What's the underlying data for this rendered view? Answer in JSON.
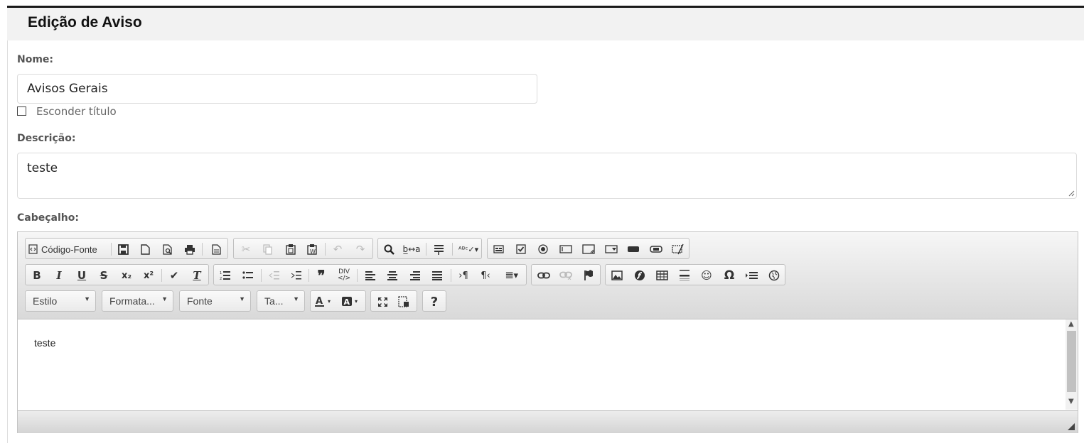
{
  "page": {
    "title": "Edição de Aviso"
  },
  "form": {
    "name_label": "Nome:",
    "name_value": "Avisos Gerais",
    "hide_title_label": "Esconder título",
    "hide_title_checked": false,
    "description_label": "Descrição:",
    "description_value": "teste",
    "header_label": "Cabeçalho:"
  },
  "editor": {
    "source_button_label": "Código-Fonte",
    "combos": {
      "style": "Estilo",
      "format": "Formata...",
      "font": "Fonte",
      "size": "Ta..."
    },
    "content_text": "teste",
    "toolbar_icons": {
      "row1": [
        "save-icon",
        "new-page-icon",
        "preview-icon",
        "print-icon",
        "templates-icon",
        "cut-icon",
        "copy-icon",
        "paste-icon",
        "paste-text-icon",
        "undo-icon",
        "redo-icon",
        "find-icon",
        "replace-icon",
        "select-all-icon",
        "spellcheck-icon",
        "form-icon",
        "checkbox-icon",
        "radio-icon",
        "textfield-icon",
        "textarea-icon",
        "select-icon",
        "button-icon",
        "image-button-icon",
        "hidden-field-icon"
      ],
      "row2": [
        "bold-icon",
        "italic-icon",
        "underline-icon",
        "strike-icon",
        "subscript-icon",
        "superscript-icon",
        "copy-format-icon",
        "remove-format-icon",
        "numbered-list-icon",
        "bulleted-list-icon",
        "outdent-icon",
        "indent-icon",
        "blockquote-icon",
        "div-icon",
        "align-left-icon",
        "align-center-icon",
        "align-right-icon",
        "justify-icon",
        "ltr-icon",
        "rtl-icon",
        "language-icon",
        "link-icon",
        "unlink-icon",
        "anchor-icon",
        "image-icon",
        "flash-icon",
        "table-icon",
        "horizontal-rule-icon",
        "smiley-icon",
        "special-char-icon",
        "page-break-icon",
        "iframe-icon"
      ],
      "row3": [
        "text-color-icon",
        "bg-color-icon",
        "maximize-icon",
        "show-blocks-icon",
        "help-icon"
      ]
    }
  }
}
